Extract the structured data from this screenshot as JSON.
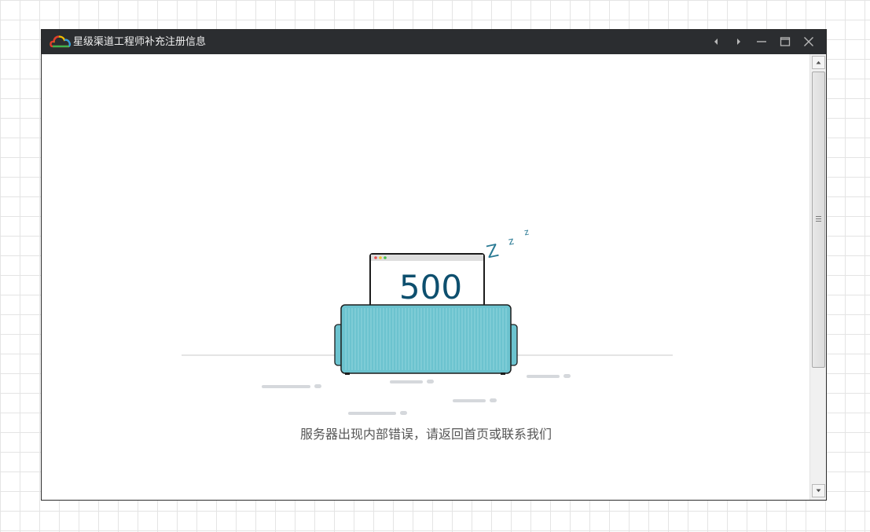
{
  "window": {
    "title": "星级渠道工程师补充注册信息",
    "logo_icon": "cloud-logo-icon",
    "controls": [
      "back-icon",
      "forward-icon",
      "minimize-icon",
      "maximize-icon",
      "close-icon"
    ]
  },
  "error": {
    "code": "500",
    "sleep_letters": [
      "Z",
      "z",
      "z"
    ],
    "message": "服务器出现内部错误，请返回首页或联系我们"
  },
  "colors": {
    "titlebar": "#2b2d30",
    "sofa": "#6cc3cf",
    "code_text": "#0d4f6e",
    "dash": "#d5d8dc"
  }
}
